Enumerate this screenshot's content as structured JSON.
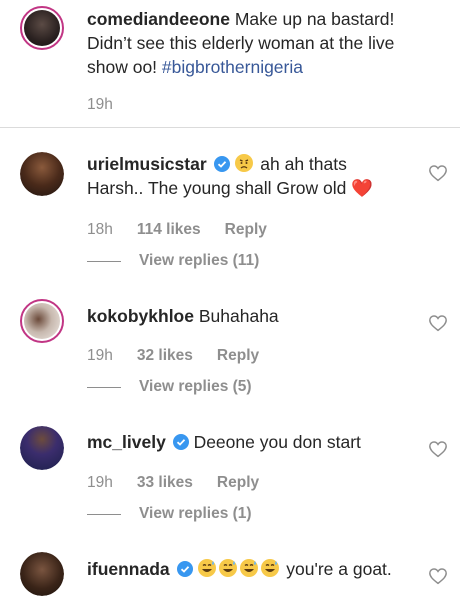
{
  "post": {
    "username": "comediandeeone",
    "caption": "Make up na bastard! Didn’t see this elderly woman at the live show oo!",
    "hashtag": "#bigbrothernigeria",
    "time": "19h"
  },
  "comments": [
    {
      "username": "urielmusicstar",
      "text_before": "ah ah thats Harsh.. The young shall Grow old",
      "emoji_after": "❤️",
      "verified": true,
      "time": "18h",
      "likes": "114 likes",
      "reply": "Reply",
      "view_replies": "View replies (11)"
    },
    {
      "username": "kokobykhloe",
      "text": "Buhahaha",
      "time": "19h",
      "likes": "32 likes",
      "reply": "Reply",
      "view_replies": "View replies (5)"
    },
    {
      "username": "mc_lively",
      "text": "Deeone you don start",
      "verified": true,
      "time": "19h",
      "likes": "33 likes",
      "reply": "Reply",
      "view_replies": "View replies (1)"
    },
    {
      "username": "ifuennada",
      "text": "you're a goat.",
      "emoji_count": 4,
      "verified": true
    }
  ],
  "colors": {
    "verified": "#3897f0",
    "heart": "#ed4956",
    "muted": "#8e8e8e",
    "hashtag": "#385898"
  }
}
